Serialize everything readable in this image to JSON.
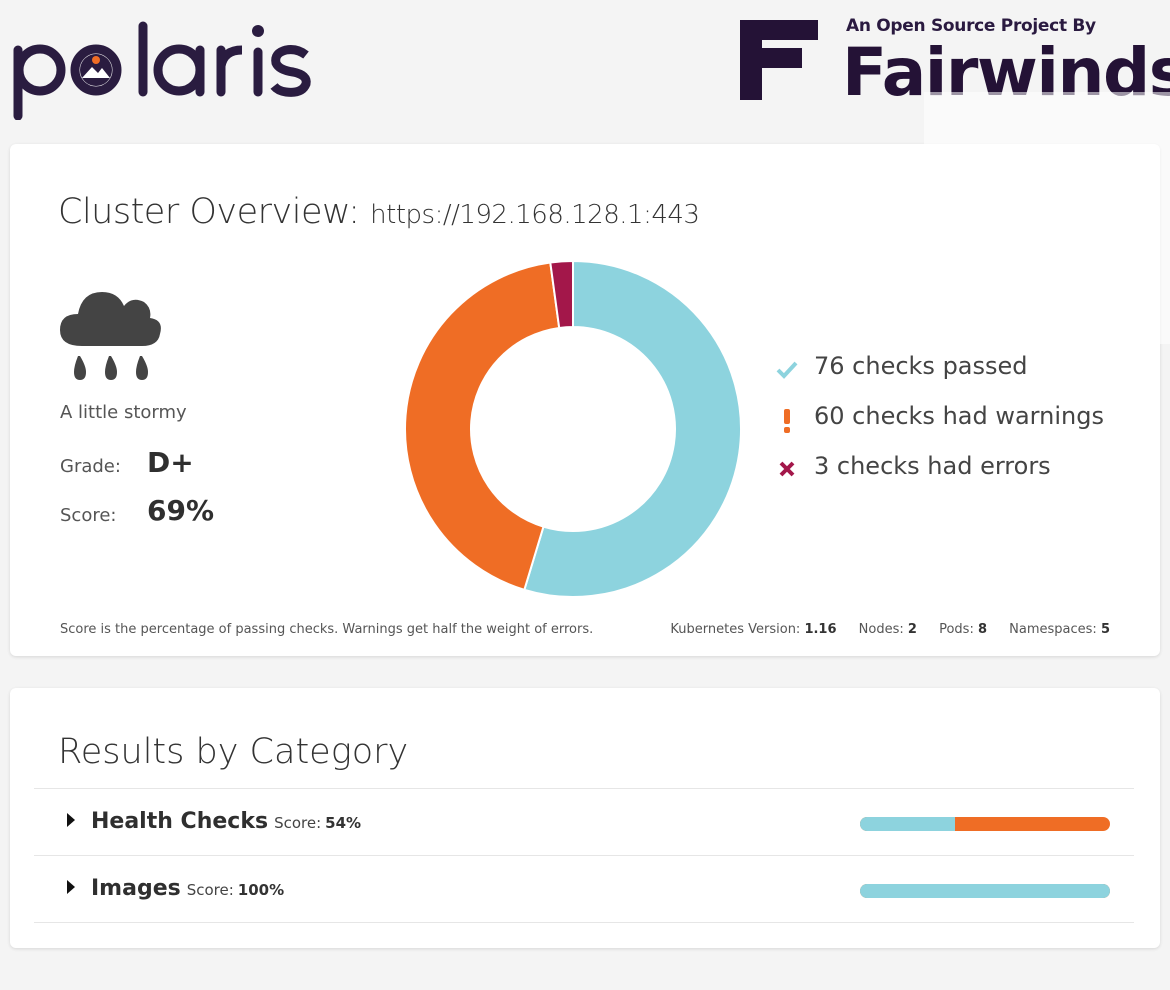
{
  "header": {
    "fw_tagline": "An Open Source Project By",
    "fw_name": "Fairwinds",
    "polaris_text": "polaris"
  },
  "overview": {
    "title": "Cluster Overview:",
    "url": "https://192.168.128.1:443",
    "weather_icon": "cloud-rain-icon",
    "weather_desc": "A little stormy",
    "grade_label": "Grade:",
    "grade": "D+",
    "score_label": "Score:",
    "score": "69%",
    "footnote": "Score is the percentage of passing checks. Warnings get half the weight of errors.",
    "k8s_label": "Kubernetes Version:",
    "k8s_version": "1.16",
    "nodes_label": "Nodes:",
    "nodes": "2",
    "pods_label": "Pods:",
    "pods": "8",
    "namespaces_label": "Namespaces:",
    "namespaces": "5",
    "legend": {
      "passed": "76 checks passed",
      "warnings": "60 checks had warnings",
      "errors": "3 checks had errors"
    }
  },
  "chart_data": {
    "type": "pie",
    "categories": [
      "passed",
      "warnings",
      "errors"
    ],
    "values": [
      76,
      60,
      3
    ],
    "colors": [
      "#8dd3de",
      "#ef6d25",
      "#a3174a"
    ]
  },
  "results": {
    "title": "Results by Category",
    "score_label": "Score:",
    "categories": [
      {
        "name": "Health Checks",
        "score": "54%",
        "pass_fraction": 0.38
      },
      {
        "name": "Images",
        "score": "100%",
        "pass_fraction": 1.0
      }
    ]
  },
  "colors": {
    "pass": "#8dd3de",
    "warning": "#ef6d25",
    "error": "#a3174a",
    "brand": "#241236"
  }
}
